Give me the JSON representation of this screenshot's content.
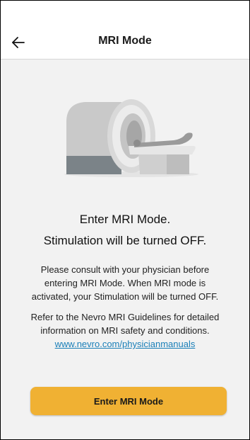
{
  "header": {
    "title": "MRI Mode",
    "back_icon": "arrow-left-icon"
  },
  "illustration": {
    "icon": "mri-scanner-illustration"
  },
  "main": {
    "heading_line1": "Enter MRI Mode.",
    "heading_line2": "Stimulation will be turned OFF.",
    "paragraph1": [
      "Please consult with your physician before",
      "entering MRI Mode. When MRI mode is",
      "activated, your Stimulation will be turned OFF."
    ],
    "paragraph2": [
      "Refer to the Nevro MRI Guidelines for detailed",
      "information on MRI safety and conditions."
    ],
    "link_text": "www.nevro.com/physicianmanuals",
    "button_label": "Enter MRI Mode"
  },
  "colors": {
    "accent": "#f0b133",
    "link": "#1a7fb8",
    "background": "#f2f2f2"
  }
}
